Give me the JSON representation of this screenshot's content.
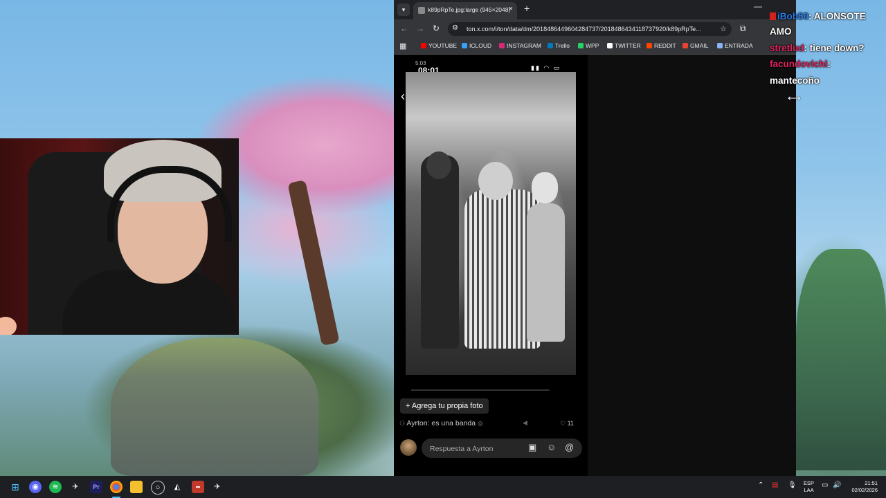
{
  "browser": {
    "tab_title": "k89pRpTe.jpg:large (945×2048)",
    "url": "ton.x.com/i/ton/data/dm/2018486449604284737/2018486434118737920/k89pRpTe...",
    "bookmarks": [
      {
        "label": "YOUTUBE",
        "color": "#ff0000"
      },
      {
        "label": "ICLOUD",
        "color": "#3aa0f0"
      },
      {
        "label": "INSTAGRAM",
        "color": "#d62976"
      },
      {
        "label": "Trello",
        "color": "#0079bf"
      },
      {
        "label": "WPP",
        "color": "#25d366"
      },
      {
        "label": "TWITTER",
        "color": "#ffffff"
      },
      {
        "label": "REDDIT",
        "color": "#ff4500"
      },
      {
        "label": "GMAIL",
        "color": "#ea4335"
      },
      {
        "label": "ENTRADA",
        "color": "#8ab4f8"
      }
    ]
  },
  "phone": {
    "time_small": "5:03",
    "time": "08:01",
    "add_photo_label": "+ Agrega tu propia foto",
    "comment_text": "Ayrton: es una banda",
    "likes": "11",
    "reply_placeholder": "Respuesta a Ayrton"
  },
  "chat": {
    "partial_top": "AMO",
    "messages": [
      {
        "user": "iBob50",
        "text": "ALONSOTE"
      },
      {
        "user": "",
        "text": "AMO"
      },
      {
        "user": "stretlud",
        "text": "tiene down?"
      },
      {
        "user": "facundovichi",
        "text": ""
      },
      {
        "user": "",
        "text": "mantecoño"
      }
    ]
  },
  "taskbar": {
    "lang_line1": "ESP",
    "lang_line2": "LAA",
    "time": "21:51",
    "date": "02/02/2026"
  }
}
